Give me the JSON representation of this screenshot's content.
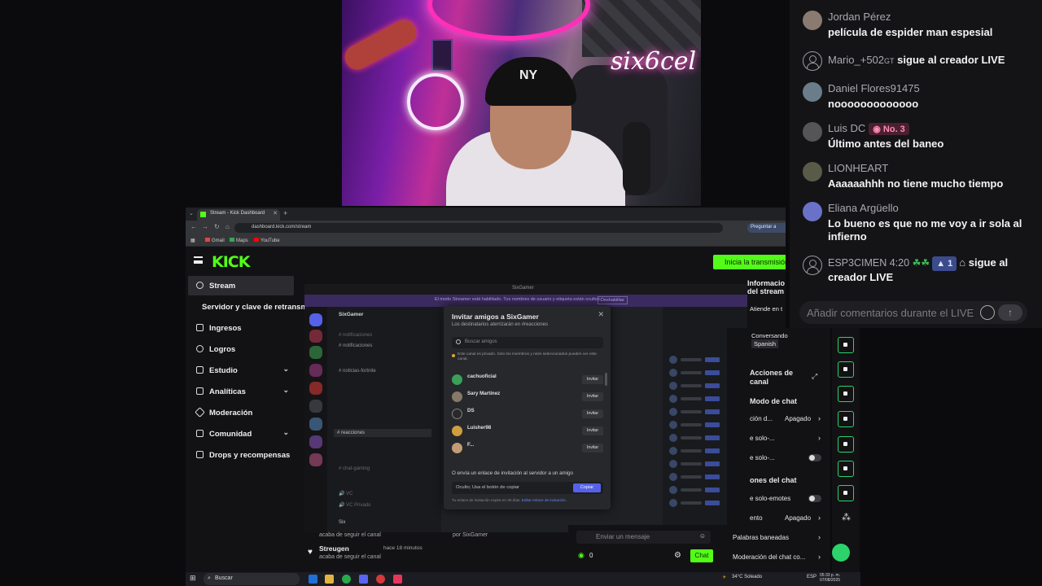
{
  "webcam": {
    "neon_sign": "six6cel",
    "cap_logo": "NY"
  },
  "chat": {
    "messages": [
      {
        "user": "Jordan Pérez",
        "text": "película de espider man espesial"
      },
      {
        "user": "Mario_+502",
        "tag": "GT",
        "text": "sigue al creador LIVE"
      },
      {
        "user": "Daniel Flores91475",
        "text": "nooooooooooooo"
      },
      {
        "user": "Luis DC",
        "badge": "No. 3",
        "text": "Último antes del baneo"
      },
      {
        "user": "LIONHEART",
        "text": "Aaaaaahhh no tiene mucho tiempo"
      },
      {
        "user": "Eliana Argüello",
        "text": "Lo bueno es que no me voy a ir sola al infierno"
      },
      {
        "user": "ESP3CIMEN 4:20",
        "badge": "1",
        "text": "sigue al creador LIVE"
      }
    ],
    "comment_placeholder": "Añadir comentarios durante el LIVE"
  },
  "browser": {
    "tab_title": "Stream - Kick Dashboard",
    "url": "dashboard.kick.com/stream",
    "ask_label": "Preguntar a",
    "bookmarks": [
      "Gmail",
      "Maps",
      "YouTube"
    ]
  },
  "kick": {
    "logo": "KICK",
    "go_live": "Inicia la transmisión",
    "sidebar": [
      {
        "label": "Stream",
        "active": true
      },
      {
        "label": "Servidor y clave de retransm"
      },
      {
        "label": "Ingresos"
      },
      {
        "label": "Logros"
      },
      {
        "label": "Estudio",
        "expandable": true
      },
      {
        "label": "Analíticas",
        "expandable": true
      },
      {
        "label": "Moderación"
      },
      {
        "label": "Comunidad",
        "expandable": true
      },
      {
        "label": "Drops y recompensas"
      }
    ],
    "info_title": "Información del stream",
    "info_lines": [
      "Atiende en t",
      "Conversando",
      "Spanish"
    ],
    "actions_title": "Acciones de canal",
    "chat_section": "Modo de chat",
    "settings": [
      {
        "label": "ción d...",
        "value": "Apagado"
      },
      {
        "label": "e solo-...",
        "value": ""
      },
      {
        "label": "e solo-...",
        "value": ""
      }
    ],
    "chat_options_title": "ones del chat",
    "emotes_only": "e solo-emotes",
    "slow": {
      "label": "ento",
      "value": "Apagado"
    },
    "banned_words": "Palabras baneadas",
    "chat_moderation": "Moderación del chat co...",
    "feed": [
      {
        "user": "Streugen",
        "time": "hace 18 minutos",
        "action": "acaba de seguir el canal"
      }
    ],
    "feed_prev_action": "acaba de seguir el canal",
    "feed_mid": "por SixGamer",
    "send_placeholder": "Enviar un mensaje",
    "viewer_count": "0",
    "chat_button": "Chat"
  },
  "discord": {
    "title_bar": "SixGamer",
    "banner": "El modo Streamer está habilitado. Tus nombres de usuario y etiqueta están ocultos.",
    "banner_button": "Deshabilitar",
    "server_name": "SixGamer",
    "channels": [
      "notificaciones",
      "notificaciones",
      "noticias-fortnite",
      "reacciones",
      "chat-gaming"
    ],
    "voice_channels": [
      "VC",
      "VC Privado"
    ],
    "user": "Six",
    "modal": {
      "title": "Invitar amigos a SixGamer",
      "subtitle": "Los destinatarios aterrizarán en #reacciones",
      "search_placeholder": "Buscar amigos",
      "note": "Este canal es privado. Solo los miembros y roles seleccionados pueden ver este canal.",
      "friends": [
        {
          "name": "cachuoficial"
        },
        {
          "name": "Sary Martínez"
        },
        {
          "name": "DS"
        },
        {
          "name": "Luisher98"
        },
        {
          "name": "F..."
        }
      ],
      "invite_label": "Invitar",
      "or_send": "O envía un enlace de invitación al servidor a un amigo",
      "link_value": "Oculto; Usa el botón de copiar",
      "copy": "Copiar",
      "expire": "Tu enlace de invitación expira en 30 días.",
      "edit_link": "Editar enlace de invitación."
    }
  },
  "taskbar": {
    "search": "Buscar",
    "weather": "34°C  Soleado",
    "lang": "ESP",
    "time": "05:33 p. m.",
    "date": "07/08/2025"
  }
}
